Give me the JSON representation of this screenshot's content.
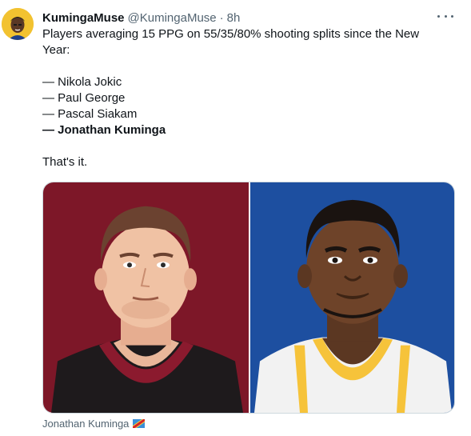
{
  "tweet": {
    "display_name": "KumingaMuse",
    "handle": "@KumingaMuse",
    "separator": "·",
    "time": "8h",
    "intro": "Players averaging 15 PPG on 55/35/80% shooting splits since the New Year:",
    "players": [
      "— Nikola Jokic",
      "— Paul George",
      "— Pascal Siakam",
      "— Jonathan Kuminga"
    ],
    "outro": "That's it.",
    "media_caption": "Jonathan Kuminga"
  },
  "icons": {
    "more": "more-options-icon",
    "flag": "dr-congo-flag-icon",
    "avatar": "profile-avatar"
  },
  "colors": {
    "left_panel_bg": "#7d1728",
    "right_panel_bg": "#1d4fa0",
    "avatar_bg": "#f2c230",
    "secondary_text": "#536471"
  }
}
